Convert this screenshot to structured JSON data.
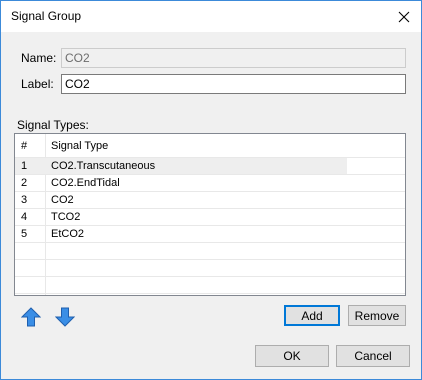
{
  "window": {
    "title": "Signal Group",
    "close_icon": "close-icon"
  },
  "form": {
    "name_label": "Name:",
    "name_value": "CO2",
    "label_label": "Label:",
    "label_value": "CO2"
  },
  "signal_types": {
    "section_label": "Signal Types:",
    "columns": [
      "#",
      "Signal Type"
    ],
    "rows": [
      {
        "num": "1",
        "type": "CO2.Transcutaneous",
        "selected": true
      },
      {
        "num": "2",
        "type": "CO2.EndTidal"
      },
      {
        "num": "3",
        "type": "CO2"
      },
      {
        "num": "4",
        "type": "TCO2"
      },
      {
        "num": "5",
        "type": "EtCO2"
      }
    ]
  },
  "actions": {
    "move_up_icon": "arrow-up-icon",
    "move_down_icon": "arrow-down-icon",
    "add_label": "Add",
    "remove_label": "Remove",
    "ok_label": "OK",
    "cancel_label": "Cancel"
  },
  "colors": {
    "accent": "#0078d7",
    "window_border": "#3c8ad9",
    "dialog_bg": "#f0f0f0",
    "arrow_fill": "#3a8ee6"
  }
}
